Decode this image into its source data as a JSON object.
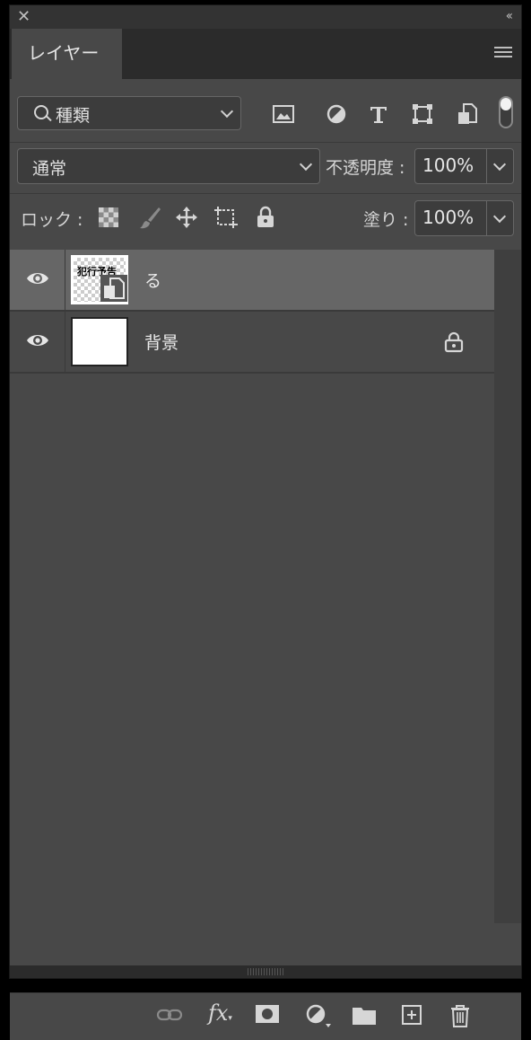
{
  "window": {
    "close_glyph": "✕",
    "collapse_glyph": "‹‹"
  },
  "tab": {
    "title": "レイヤー"
  },
  "filter": {
    "kind_label": "種類",
    "icons": [
      "image-filter-icon",
      "adjustment-filter-icon",
      "type-filter-icon",
      "shape-filter-icon",
      "smart-object-filter-icon"
    ]
  },
  "blend": {
    "mode": "通常",
    "opacity_label": "不透明度 :",
    "opacity_value": "100%"
  },
  "lock": {
    "label": "ロック :",
    "fill_label": "塗り :",
    "fill_value": "100%"
  },
  "layers": [
    {
      "name": "る",
      "visible": true,
      "selected": true,
      "thumb_text": "犯行予告",
      "locked": false
    },
    {
      "name": "背景",
      "visible": true,
      "selected": false,
      "thumb_text": "",
      "locked": true
    }
  ],
  "colors": {
    "panel_bg": "#484848",
    "selected_row": "#666666",
    "header_bg": "#2b2b2b"
  }
}
